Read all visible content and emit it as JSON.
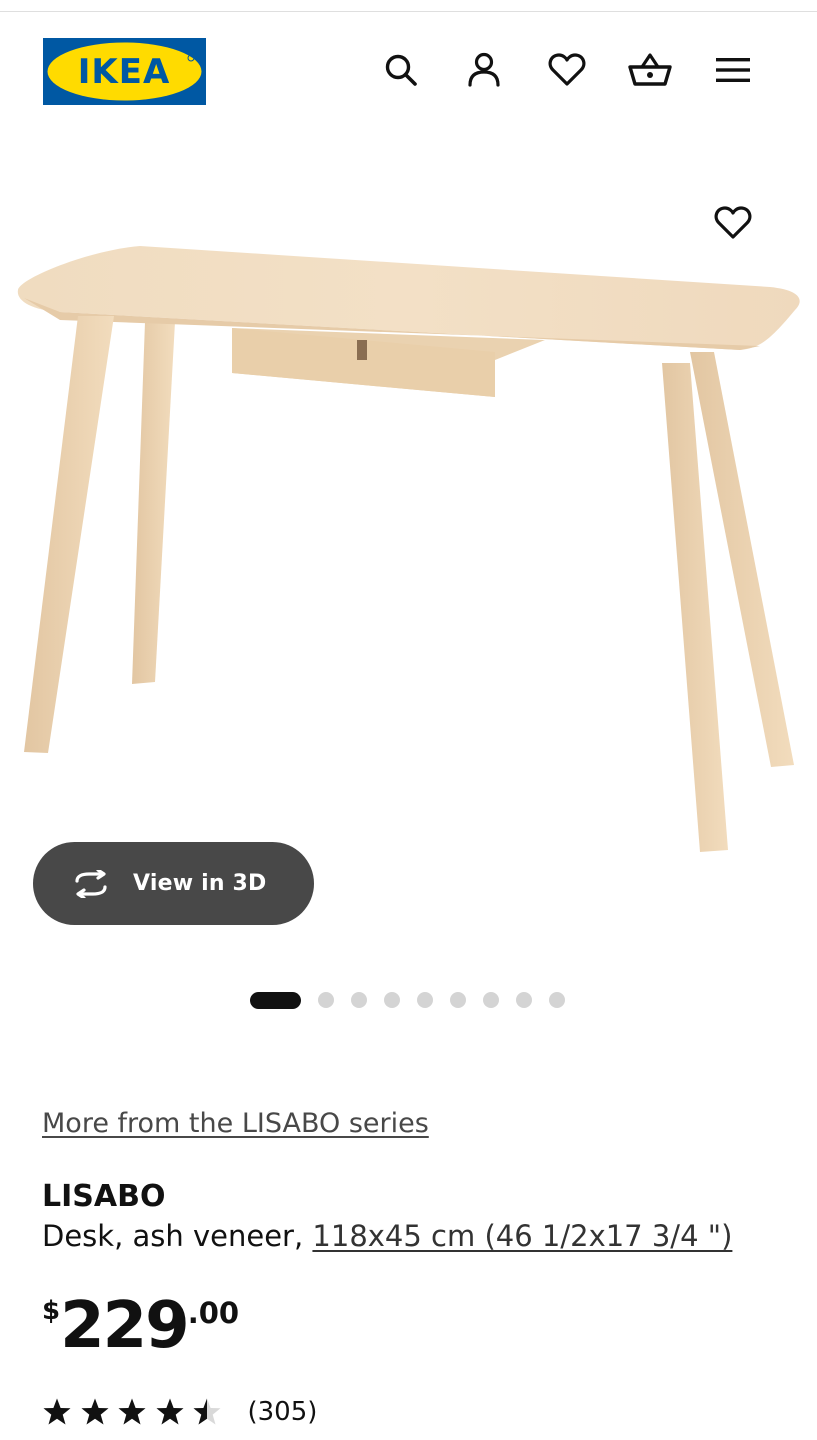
{
  "header": {
    "logo_text": "IKEA",
    "icons": [
      "search-icon",
      "account-icon",
      "heart-icon",
      "basket-icon",
      "menu-icon"
    ],
    "colors": {
      "logo_blue": "#0058a3",
      "logo_yellow": "#ffdb00"
    }
  },
  "gallery": {
    "view_3d_label": "View in 3D",
    "slide_count": 9,
    "active_slide": 1
  },
  "product": {
    "series_link": "More from the LISABO series",
    "name": "LISABO",
    "description": "Desk, ash veneer, ",
    "size": "118x45 cm (46 1/2x17 3/4 \")",
    "price": {
      "currency": "$",
      "integer": "229",
      "decimal": ".00"
    },
    "rating": {
      "value": 4.5,
      "max": 5,
      "review_count": "(305)"
    }
  }
}
